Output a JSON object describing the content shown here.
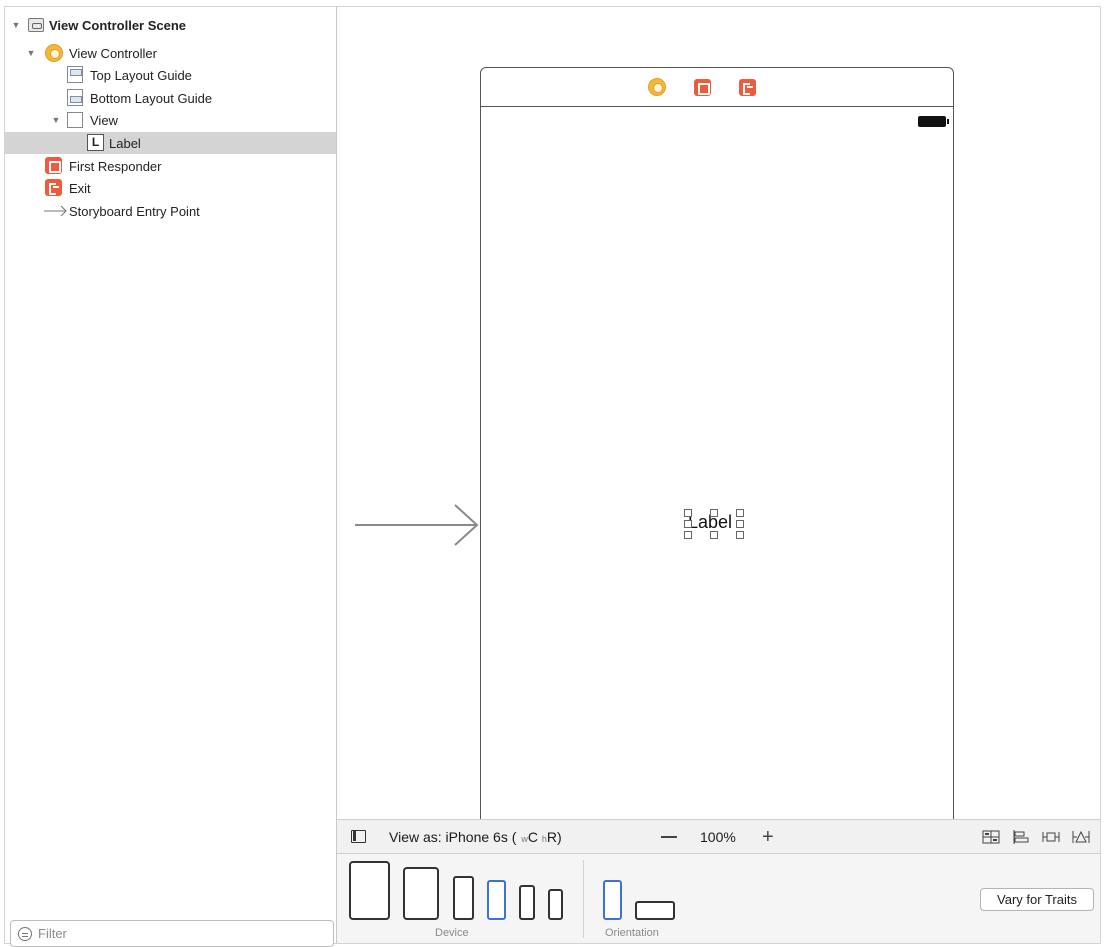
{
  "outline": {
    "items": [
      {
        "label": "View Controller Scene",
        "icon": "scene-icon"
      },
      {
        "label": "View Controller",
        "icon": "view-controller-icon"
      },
      {
        "label": "Top Layout Guide",
        "icon": "layout-guide-icon"
      },
      {
        "label": "Bottom Layout Guide",
        "icon": "layout-guide-icon"
      },
      {
        "label": "View",
        "icon": "view-icon"
      },
      {
        "label": "Label",
        "icon": "label-icon"
      },
      {
        "label": "First Responder",
        "icon": "first-responder-icon"
      },
      {
        "label": "Exit",
        "icon": "exit-icon"
      },
      {
        "label": "Storyboard Entry Point",
        "icon": "entry-arrow-icon"
      }
    ],
    "selected_item": "Label",
    "filter_placeholder": "Filter"
  },
  "canvas": {
    "label_text": "Label",
    "colors": {
      "view_controller": "#f3b83a",
      "first_responder": "#ee5b3c",
      "exit": "#ee5b3c",
      "selected_device": "#3a73d1"
    }
  },
  "toolbar": {
    "view_as_label": "View as: iPhone 6s (",
    "size_w_prefix": "w",
    "size_w_value": "C",
    "size_h_prefix": "h",
    "size_h_value": "R",
    "size_close": ")",
    "zoom_level": "100%"
  },
  "device_panel": {
    "device_caption": "Device",
    "orientation_caption": "Orientation",
    "vary_for_traits_label": "Vary for Traits"
  }
}
